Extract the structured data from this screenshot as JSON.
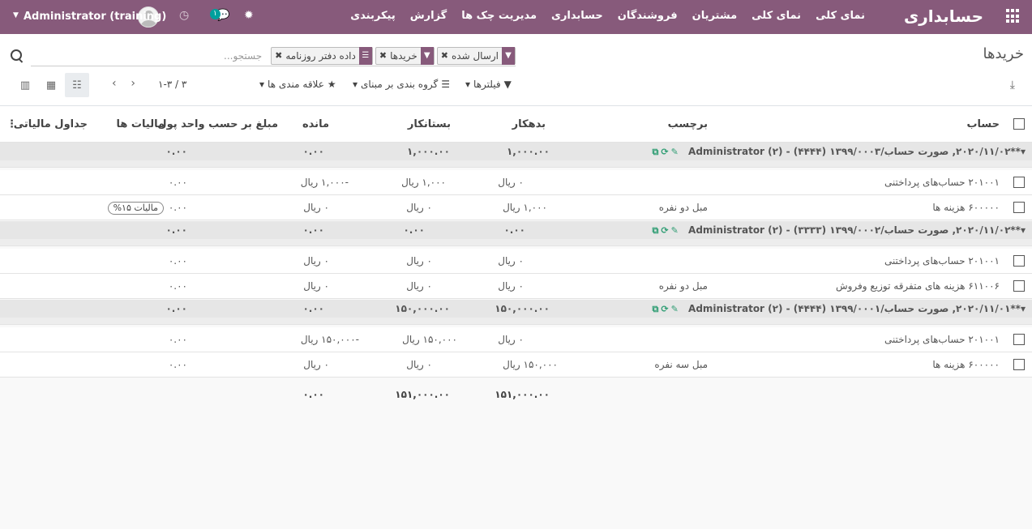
{
  "navbar": {
    "brand": "حسابداری",
    "menu": [
      "نمای کلی",
      "نمای کلی",
      "مشتریان",
      "فروشندگان",
      "حسابداری",
      "مدیریت چک ها",
      "گزارش",
      "پیکربندی"
    ],
    "user_name": "Administrator (training)",
    "chat_count": "۱"
  },
  "breadcrumb": "خریدها",
  "search": {
    "placeholder": "جستجو...",
    "facets": [
      {
        "icon": "filter-icon",
        "value": "ارسال شده"
      },
      {
        "icon": "filter-icon",
        "value": "خریدها"
      },
      {
        "icon": "groupby-icon",
        "value": "داده دفتر روزنامه"
      }
    ]
  },
  "controls": {
    "filters_label": "فیلترها",
    "groupby_label": "گروه بندی بر مبنای",
    "favorites_label": "علاقه مندی ها",
    "pager": "۱-۳ / ۳"
  },
  "columns": {
    "account": "حساب",
    "label": "برچسب",
    "debit": "بدهکار",
    "credit": "بستانکار",
    "balance": "مانده",
    "amount_currency": "مبلغ بر حسب واحد پول",
    "taxes": "مالیات ها",
    "tax_grids": "جداول مالیاتی"
  },
  "groups": [
    {
      "title": "**۲۰۲۰/۱۱/۰۲, صورت حساب/۱۳۹۹/۰۰۰۳ (۴۴۴۴) - Administrator (۲)",
      "debit": "۱,۰۰۰.۰۰",
      "credit": "۱,۰۰۰.۰۰",
      "balance": "۰.۰۰",
      "amount": "۰.۰۰",
      "lines": [
        {
          "account": "۲۰۱۰۰۱ حساب‌های پرداختنی",
          "label": "",
          "debit": "۰ ریال",
          "credit": "۱,۰۰۰ ریال",
          "balance": "-۱,۰۰۰ ریال",
          "amount": "۰.۰۰",
          "tax": ""
        },
        {
          "account": "۶۰۰۰۰۰ هزینه ها",
          "label": "مبل دو نفره",
          "debit": "۱,۰۰۰ ریال",
          "credit": "۰ ریال",
          "balance": "۰ ریال",
          "amount": "۰.۰۰",
          "tax": "مالیات ۱۵%"
        }
      ]
    },
    {
      "title": "**۲۰۲۰/۱۱/۰۲, صورت حساب/۱۳۹۹/۰۰۰۲ (۳۳۳۳) - Administrator (۲)",
      "debit": "۰.۰۰",
      "credit": "۰.۰۰",
      "balance": "۰.۰۰",
      "amount": "۰.۰۰",
      "lines": [
        {
          "account": "۲۰۱۰۰۱ حساب‌های پرداختنی",
          "label": "",
          "debit": "۰ ریال",
          "credit": "۰ ریال",
          "balance": "۰ ریال",
          "amount": "۰.۰۰",
          "tax": ""
        },
        {
          "account": "۶۱۱۰۰۶ هزینه های متفرقه توزیع وفروش",
          "label": "مبل دو نفره",
          "debit": "۰ ریال",
          "credit": "۰ ریال",
          "balance": "۰ ریال",
          "amount": "۰.۰۰",
          "tax": ""
        }
      ]
    },
    {
      "title": "**۲۰۲۰/۱۱/۰۱, صورت حساب/۱۳۹۹/۰۰۰۱ (۴۴۴۴) - Administrator (۲)",
      "debit": "۱۵۰,۰۰۰.۰۰",
      "credit": "۱۵۰,۰۰۰.۰۰",
      "balance": "۰.۰۰",
      "amount": "۰.۰۰",
      "lines": [
        {
          "account": "۲۰۱۰۰۱ حساب‌های پرداختنی",
          "label": "",
          "debit": "۰ ریال",
          "credit": "۱۵۰,۰۰۰ ریال",
          "balance": "-۱۵۰,۰۰۰ ریال",
          "amount": "۰.۰۰",
          "tax": ""
        },
        {
          "account": "۶۰۰۰۰۰ هزینه ها",
          "label": "مبل سه نفره",
          "debit": "۱۵۰,۰۰۰ ریال",
          "credit": "۰ ریال",
          "balance": "۰ ریال",
          "amount": "۰.۰۰",
          "tax": ""
        }
      ]
    }
  ],
  "totals": {
    "debit": "۱۵۱,۰۰۰.۰۰",
    "credit": "۱۵۱,۰۰۰.۰۰",
    "balance": "۰.۰۰"
  },
  "colors": {
    "brand": "#875a7b",
    "group_icons": "#2e9d73"
  }
}
